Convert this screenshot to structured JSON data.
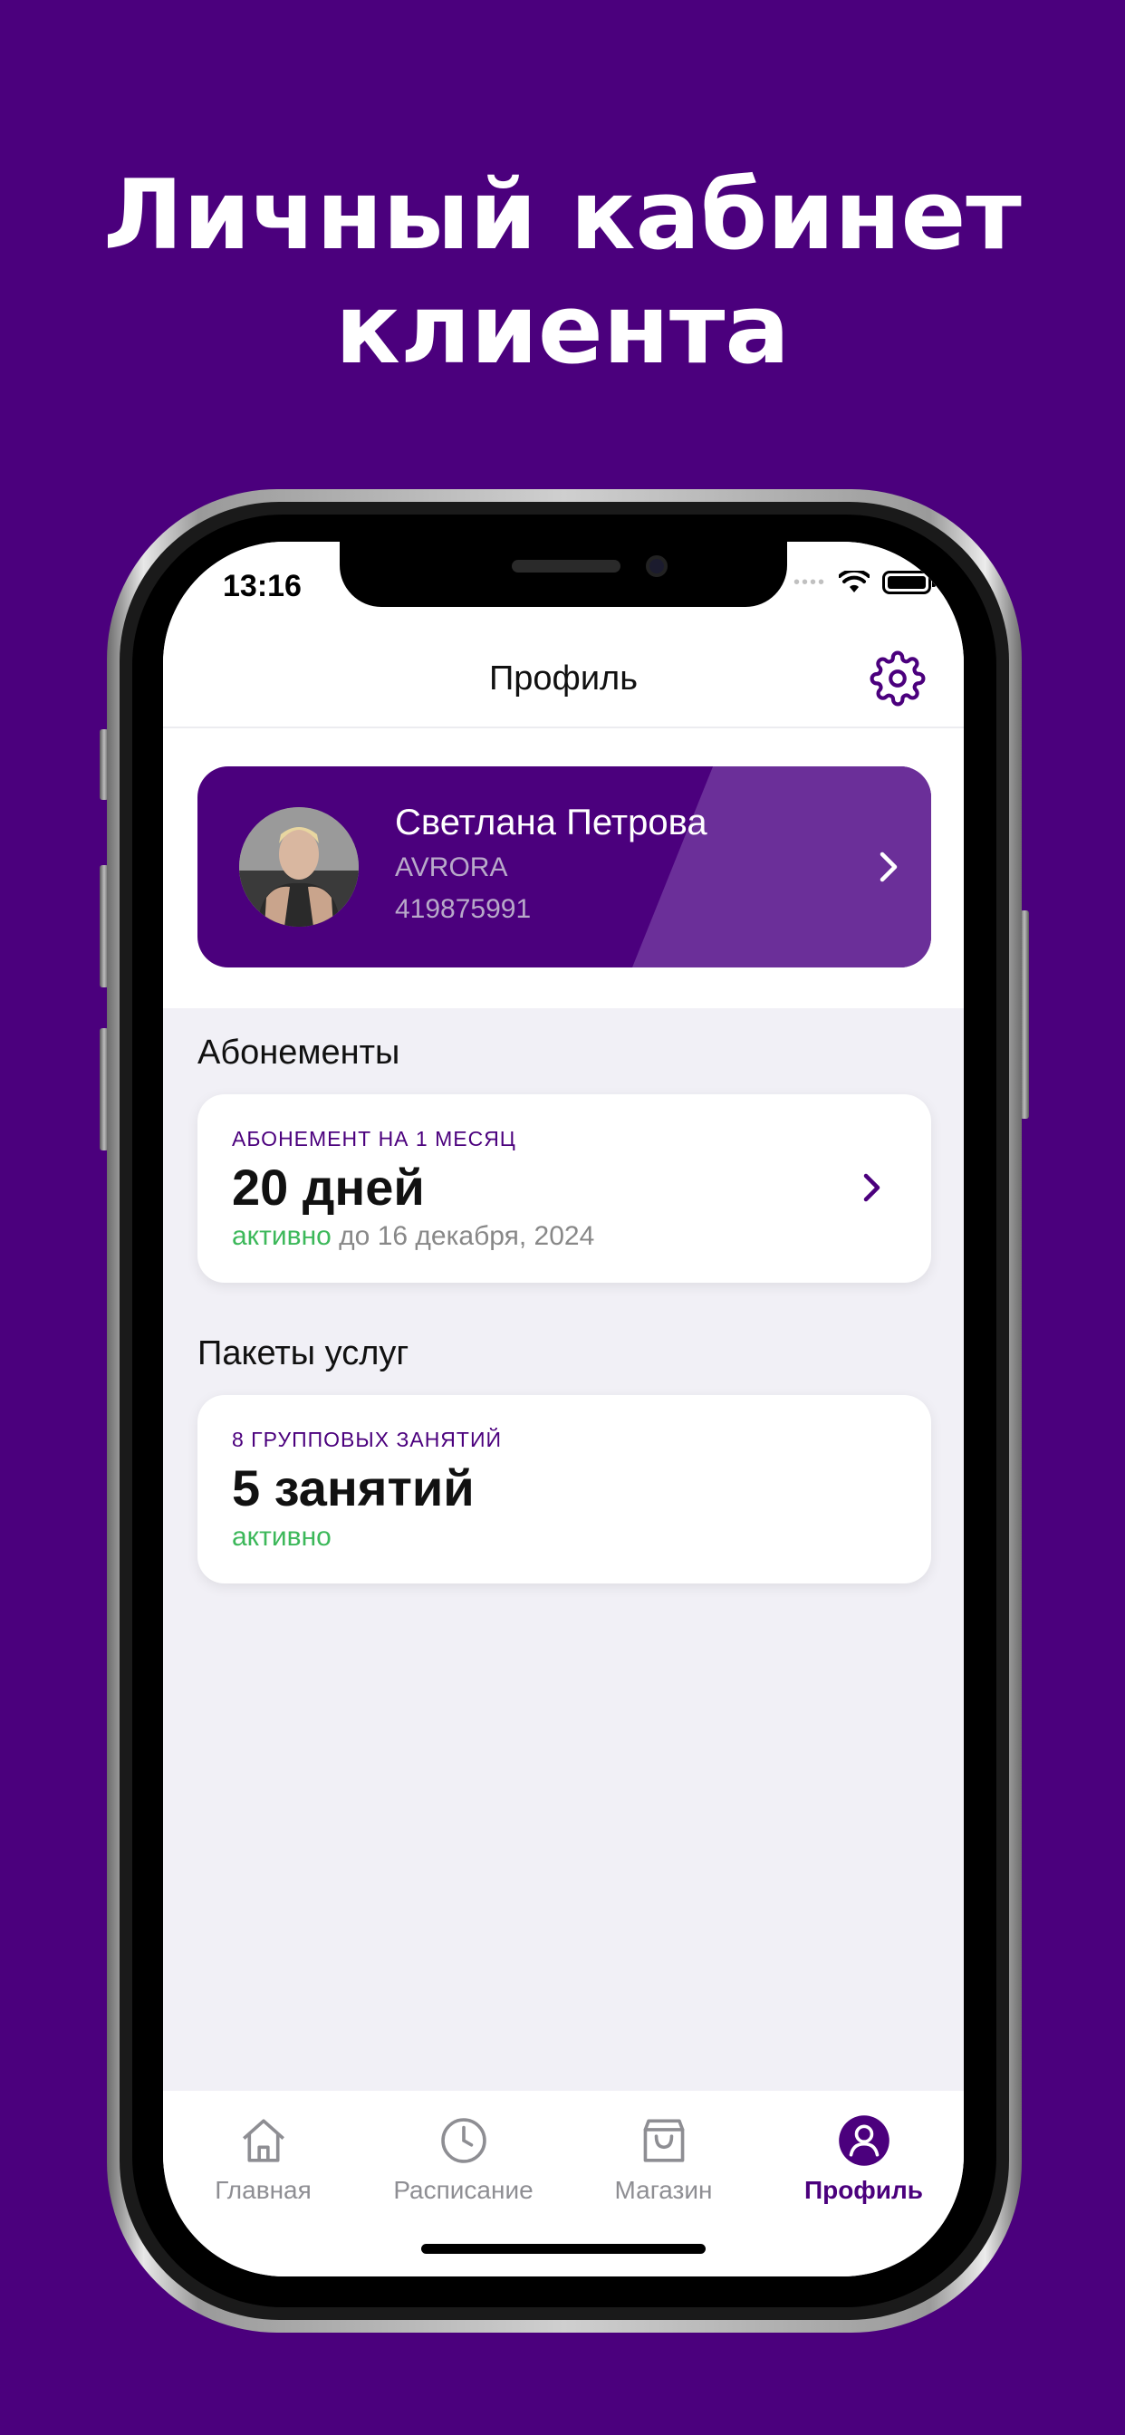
{
  "headline": {
    "line1": "Личный кабинет",
    "line2": "клиента"
  },
  "status_bar": {
    "time": "13:16",
    "signal": "••••"
  },
  "nav": {
    "title": "Профиль"
  },
  "profile": {
    "name": "Светлана Петрова",
    "club": "AVRORA",
    "id": "419875991"
  },
  "memberships": {
    "section_title": "Абонементы",
    "card": {
      "label": "АБОНЕМЕНТ НА 1 МЕСЯЦ",
      "value": "20 дней",
      "status": "активно",
      "until": " до 16 декабря, 2024"
    }
  },
  "packages": {
    "section_title": "Пакеты услуг",
    "card": {
      "label": "8 ГРУППОВЫХ ЗАНЯТИЙ",
      "value": "5 занятий",
      "status": "активно"
    }
  },
  "tabbar": {
    "tabs": [
      {
        "label": "Главная",
        "icon": "home-icon"
      },
      {
        "label": "Расписание",
        "icon": "clock-icon"
      },
      {
        "label": "Магазин",
        "icon": "bag-icon"
      },
      {
        "label": "Профиль",
        "icon": "profile-icon",
        "active": true
      }
    ]
  },
  "colors": {
    "brand": "#4b007d",
    "active_status": "#3cb85a",
    "inactive_tab": "#8e8e93"
  }
}
